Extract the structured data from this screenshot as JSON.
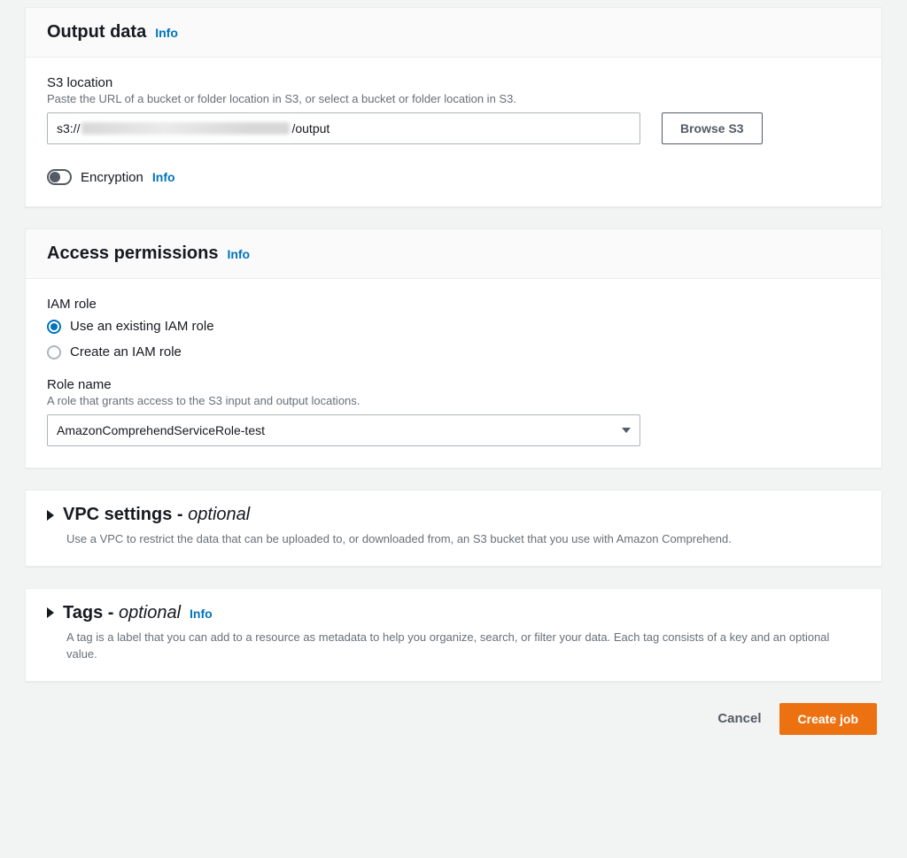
{
  "output_data": {
    "title": "Output data",
    "info": "Info",
    "s3_label": "S3 location",
    "s3_desc": "Paste the URL of a bucket or folder location in S3, or select a bucket or folder location in S3.",
    "s3_prefix": "s3://",
    "s3_suffix": "/output",
    "browse_label": "Browse S3",
    "encryption_label": "Encryption",
    "encryption_info": "Info"
  },
  "access_permissions": {
    "title": "Access permissions",
    "info": "Info",
    "iam_label": "IAM role",
    "radio_existing": "Use an existing IAM role",
    "radio_create": "Create an IAM role",
    "role_name_label": "Role name",
    "role_name_desc": "A role that grants access to the S3 input and output locations.",
    "role_value": "AmazonComprehendServiceRole-test"
  },
  "vpc": {
    "title_prefix": "VPC settings - ",
    "title_optional": "optional",
    "desc": "Use a VPC to restrict the data that can be uploaded to, or downloaded from, an S3 bucket that you use with Amazon Comprehend."
  },
  "tags": {
    "title_prefix": "Tags - ",
    "title_optional": "optional",
    "info": "Info",
    "desc": "A tag is a label that you can add to a resource as metadata to help you organize, search, or filter your data. Each tag consists of a key and an optional value."
  },
  "footer": {
    "cancel": "Cancel",
    "create": "Create job"
  }
}
